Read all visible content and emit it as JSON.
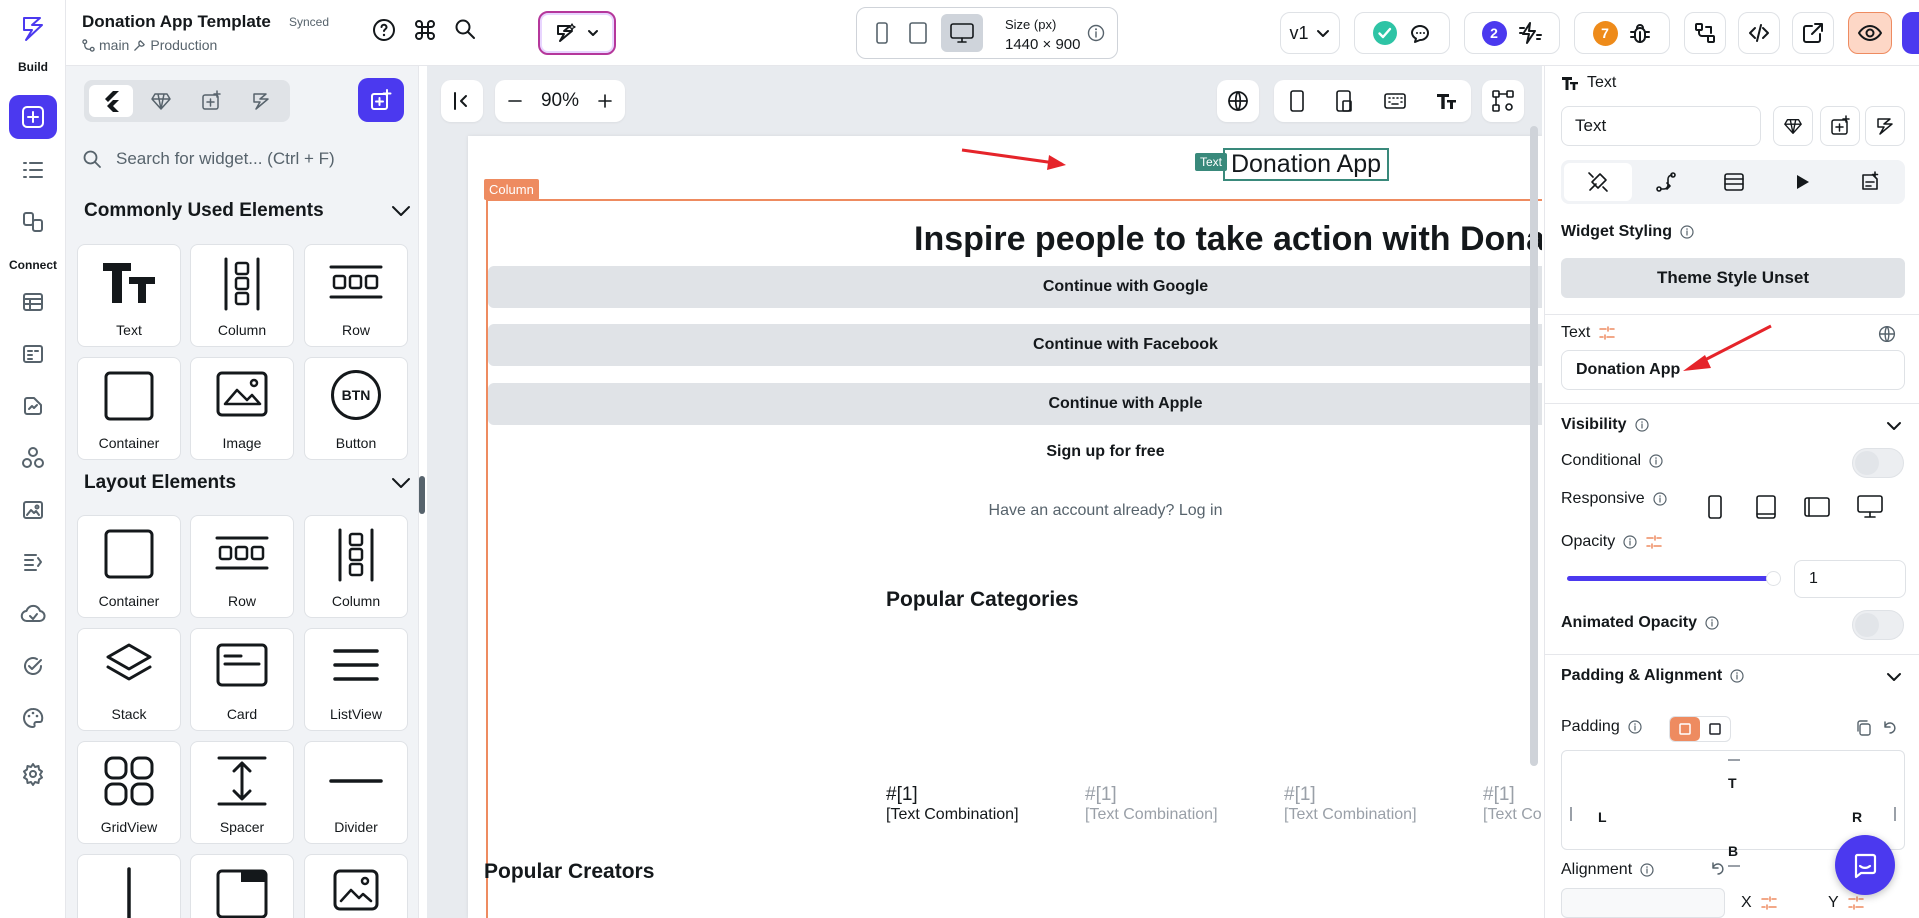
{
  "rail": {
    "build_label": "Build",
    "connect_label": "Connect",
    "items": [
      {
        "icon": "add-widget-icon",
        "active": true
      },
      {
        "icon": "widget-tree-icon"
      },
      {
        "icon": "page-selector-icon"
      },
      {
        "icon": "database-icon"
      },
      {
        "icon": "app-state-icon"
      },
      {
        "icon": "storage-icon"
      },
      {
        "icon": "api-icon"
      },
      {
        "icon": "media-icon"
      },
      {
        "icon": "custom-code-icon"
      },
      {
        "icon": "cloud-icon"
      },
      {
        "icon": "test-icon"
      },
      {
        "icon": "theme-icon"
      },
      {
        "icon": "settings-icon"
      }
    ]
  },
  "header": {
    "project_name": "Donation App Template",
    "sync_status": "Synced",
    "branch": "main",
    "environment": "Production",
    "size_label": "Size (px)",
    "size_value": "1440 × 900",
    "version": "v1",
    "badge_count_1": "2",
    "badge_count_2": "7",
    "badge_color_1": "#4b39ef",
    "badge_color_2": "#ee8b1a"
  },
  "widgets": {
    "search_placeholder": "Search for widget... (Ctrl + F)",
    "common_title": "Commonly Used Elements",
    "common": [
      "Text",
      "Column",
      "Row",
      "Container",
      "Image",
      "Button"
    ],
    "layout_title": "Layout Elements",
    "layout": [
      "Container",
      "Row",
      "Column",
      "Stack",
      "Card",
      "ListView",
      "GridView",
      "Spacer",
      "Divider"
    ],
    "button_icon_text": "BTN"
  },
  "canvas": {
    "zoom": "90%",
    "app_title": "Donation App",
    "text_tag": "Text",
    "column_tag": "Column",
    "headline": "Inspire people to take action with Donati",
    "buttons": [
      "Continue with Google",
      "Continue with Facebook",
      "Continue with Apple"
    ],
    "signup": "Sign up for free",
    "have_account": "Have an account already? Log in",
    "popular_categories": "Popular Categories",
    "category_items": [
      {
        "num": "#[1]",
        "text": "[Text Combination]"
      },
      {
        "num": "#[1]",
        "text": "[Text Combination]"
      },
      {
        "num": "#[1]",
        "text": "[Text Combination]"
      },
      {
        "num": "#[1]",
        "text": "[Text Combination]"
      }
    ],
    "popular_creators": "Popular Creators"
  },
  "properties": {
    "widget_type": "Text",
    "widget_name": "Text",
    "widget_styling": "Widget Styling",
    "theme_style": "Theme Style Unset",
    "text_label": "Text",
    "text_value": "Donation App",
    "visibility": "Visibility",
    "conditional": "Conditional",
    "responsive": "Responsive",
    "opacity": "Opacity",
    "opacity_value": "1",
    "opacity_level": 1.0,
    "animated_opacity": "Animated Opacity",
    "padding_alignment": "Padding & Alignment",
    "padding": "Padding",
    "pad_t": "T",
    "pad_l": "L",
    "pad_r": "R",
    "pad_b": "B",
    "alignment": "Alignment",
    "align_x": "X",
    "align_y": "Y"
  },
  "colors": {
    "brand": "#4b39ef",
    "selection": "#39897b",
    "column": "#ee8b60",
    "annotation": "#e5242a"
  }
}
